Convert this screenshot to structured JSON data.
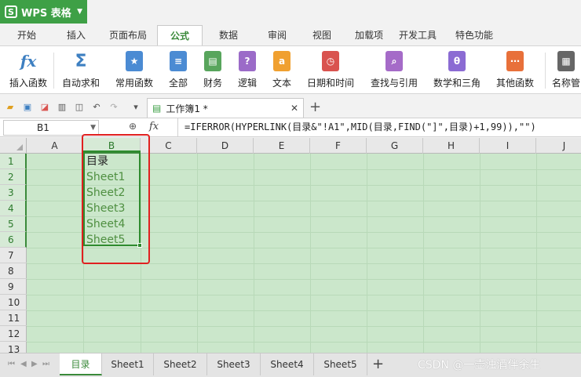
{
  "app": {
    "title": "WPS 表格"
  },
  "menu_tabs": [
    {
      "label": "开始"
    },
    {
      "label": "插入"
    },
    {
      "label": "页面布局"
    },
    {
      "label": "公式"
    },
    {
      "label": "数据"
    },
    {
      "label": "审阅"
    },
    {
      "label": "视图"
    },
    {
      "label": "加载项"
    },
    {
      "label": "开发工具"
    },
    {
      "label": "特色功能"
    }
  ],
  "active_tab": "公式",
  "ribbon": [
    {
      "label": "插入函数",
      "icon": "fx-icon",
      "color": "#3d7fc1"
    },
    {
      "label": "自动求和",
      "icon": "sigma-icon",
      "color": "#3d7fc1"
    },
    {
      "label": "常用函数",
      "icon": "star-function-icon",
      "color": "#4b8bd3"
    },
    {
      "label": "全部",
      "icon": "list-function-icon",
      "color": "#4b8bd3"
    },
    {
      "label": "财务",
      "icon": "finance-icon",
      "color": "#58a55c"
    },
    {
      "label": "逻辑",
      "icon": "logic-icon",
      "color": "#9b6bc8"
    },
    {
      "label": "文本",
      "icon": "text-icon",
      "color": "#f0a030"
    },
    {
      "label": "日期和时间",
      "icon": "clock-icon",
      "color": "#d9534f"
    },
    {
      "label": "查找与引用",
      "icon": "search-ref-icon",
      "color": "#a56bc8"
    },
    {
      "label": "数学和三角",
      "icon": "math-icon",
      "color": "#8b6bd3"
    },
    {
      "label": "其他函数",
      "icon": "other-function-icon",
      "color": "#e8703a"
    },
    {
      "label": "名称管",
      "icon": "name-manager-icon",
      "color": "#666666"
    }
  ],
  "document": {
    "tab_title": "工作簿1 *"
  },
  "formula_bar": {
    "cell_ref": "B1",
    "fx": "fx",
    "formula": "=IFERROR(HYPERLINK(目录&\"!A1\",MID(目录,FIND(\"]\",目录)+1,99)),\"\")"
  },
  "columns": [
    "A",
    "B",
    "C",
    "D",
    "E",
    "F",
    "G",
    "H",
    "I",
    "J"
  ],
  "rows": [
    "1",
    "2",
    "3",
    "4",
    "5",
    "6",
    "7",
    "8",
    "9",
    "10",
    "11",
    "12",
    "13"
  ],
  "cells": {
    "b1": "目录",
    "b2": "Sheet1",
    "b3": "Sheet2",
    "b4": "Sheet3",
    "b5": "Sheet4",
    "b6": "Sheet5"
  },
  "sheets": [
    {
      "label": "目录"
    },
    {
      "label": "Sheet1"
    },
    {
      "label": "Sheet2"
    },
    {
      "label": "Sheet3"
    },
    {
      "label": "Sheet4"
    },
    {
      "label": "Sheet5"
    }
  ],
  "watermark": "CSDN @一壶浊酒伴余生",
  "colors": {
    "brand": "#3ea046",
    "grid": "#cbe7cb",
    "highlight": "#e02020"
  }
}
